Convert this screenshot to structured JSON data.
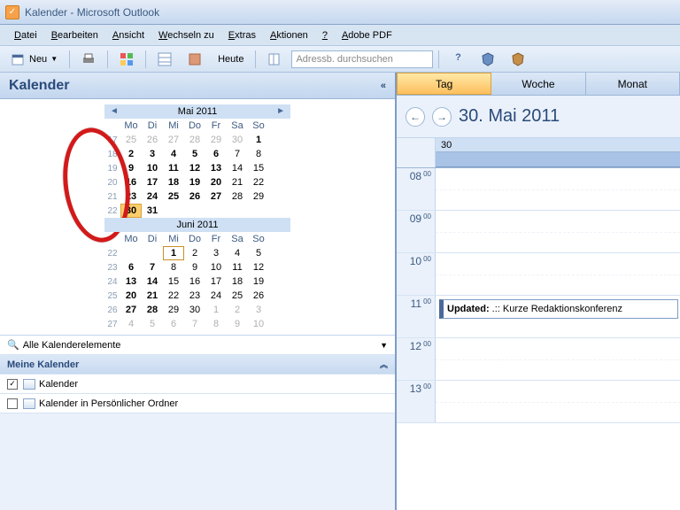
{
  "title": "Kalender - Microsoft Outlook",
  "menu": [
    "Datei",
    "Bearbeiten",
    "Ansicht",
    "Wechseln zu",
    "Extras",
    "Aktionen",
    "?",
    "Adobe PDF"
  ],
  "toolbar": {
    "neu": "Neu",
    "heute": "Heute",
    "search_placeholder": "Adressb. durchsuchen"
  },
  "sidebar": {
    "title": "Kalender",
    "all_items": "Alle Kalenderelemente",
    "my_cals": "Meine Kalender",
    "cals": [
      {
        "checked": true,
        "label": "Kalender"
      },
      {
        "checked": false,
        "label": "Kalender in Persönlicher Ordner"
      }
    ]
  },
  "minical": {
    "months": [
      {
        "title": "Mai 2011",
        "dow": [
          "Mo",
          "Di",
          "Mi",
          "Do",
          "Fr",
          "Sa",
          "So"
        ],
        "weeks": [
          {
            "wk": "17",
            "days": [
              {
                "d": 25,
                "g": 1
              },
              {
                "d": 26,
                "g": 1
              },
              {
                "d": 27,
                "g": 1
              },
              {
                "d": 28,
                "g": 1
              },
              {
                "d": 29,
                "g": 1
              },
              {
                "d": 30,
                "g": 1
              },
              {
                "d": 1,
                "b": 1
              }
            ]
          },
          {
            "wk": "18",
            "days": [
              {
                "d": 2,
                "b": 1
              },
              {
                "d": 3,
                "b": 1
              },
              {
                "d": 4,
                "b": 1
              },
              {
                "d": 5,
                "b": 1
              },
              {
                "d": 6,
                "b": 1
              },
              {
                "d": 7
              },
              {
                "d": 8
              }
            ]
          },
          {
            "wk": "19",
            "days": [
              {
                "d": 9,
                "b": 1
              },
              {
                "d": 10,
                "b": 1
              },
              {
                "d": 11,
                "b": 1
              },
              {
                "d": 12,
                "b": 1
              },
              {
                "d": 13,
                "b": 1
              },
              {
                "d": 14
              },
              {
                "d": 15
              }
            ]
          },
          {
            "wk": "20",
            "days": [
              {
                "d": 16,
                "b": 1
              },
              {
                "d": 17,
                "b": 1
              },
              {
                "d": 18,
                "b": 1
              },
              {
                "d": 19,
                "b": 1
              },
              {
                "d": 20,
                "b": 1
              },
              {
                "d": 21
              },
              {
                "d": 22
              }
            ]
          },
          {
            "wk": "21",
            "days": [
              {
                "d": 23,
                "b": 1
              },
              {
                "d": 24,
                "b": 1
              },
              {
                "d": 25,
                "b": 1
              },
              {
                "d": 26,
                "b": 1
              },
              {
                "d": 27,
                "b": 1
              },
              {
                "d": 28
              },
              {
                "d": 29
              }
            ]
          },
          {
            "wk": "22",
            "days": [
              {
                "d": 30,
                "b": 1,
                "today": 1
              },
              {
                "d": 31,
                "b": 1
              },
              {
                "d": ""
              },
              {
                "d": ""
              },
              {
                "d": ""
              },
              {
                "d": ""
              },
              {
                "d": ""
              }
            ]
          }
        ]
      },
      {
        "title": "Juni 2011",
        "dow": [
          "Mo",
          "Di",
          "Mi",
          "Do",
          "Fr",
          "Sa",
          "So"
        ],
        "weeks": [
          {
            "wk": "22",
            "days": [
              {
                "d": ""
              },
              {
                "d": ""
              },
              {
                "d": 1,
                "b": 1,
                "box": 1
              },
              {
                "d": 2
              },
              {
                "d": 3
              },
              {
                "d": 4
              },
              {
                "d": 5
              }
            ]
          },
          {
            "wk": "23",
            "days": [
              {
                "d": 6,
                "b": 1
              },
              {
                "d": 7,
                "b": 1
              },
              {
                "d": 8
              },
              {
                "d": 9
              },
              {
                "d": 10
              },
              {
                "d": 11
              },
              {
                "d": 12
              }
            ]
          },
          {
            "wk": "24",
            "days": [
              {
                "d": 13,
                "b": 1
              },
              {
                "d": 14,
                "b": 1
              },
              {
                "d": 15
              },
              {
                "d": 16
              },
              {
                "d": 17
              },
              {
                "d": 18
              },
              {
                "d": 19
              }
            ]
          },
          {
            "wk": "25",
            "days": [
              {
                "d": 20,
                "b": 1
              },
              {
                "d": 21,
                "b": 1
              },
              {
                "d": 22
              },
              {
                "d": 23
              },
              {
                "d": 24
              },
              {
                "d": 25
              },
              {
                "d": 26
              }
            ]
          },
          {
            "wk": "26",
            "days": [
              {
                "d": 27,
                "b": 1
              },
              {
                "d": 28,
                "b": 1
              },
              {
                "d": 29
              },
              {
                "d": 30
              },
              {
                "d": 1,
                "g": 1
              },
              {
                "d": 2,
                "g": 1
              },
              {
                "d": 3,
                "g": 1
              }
            ]
          },
          {
            "wk": "27",
            "days": [
              {
                "d": 4,
                "g": 1
              },
              {
                "d": 5,
                "g": 1
              },
              {
                "d": 6,
                "g": 1
              },
              {
                "d": 7,
                "g": 1
              },
              {
                "d": 8,
                "g": 1
              },
              {
                "d": 9,
                "g": 1
              },
              {
                "d": 10,
                "g": 1
              }
            ]
          }
        ]
      }
    ]
  },
  "schedule": {
    "tabs": [
      "Tag",
      "Woche",
      "Monat"
    ],
    "active_tab": 0,
    "date": "30. Mai 2011",
    "daynum": "30",
    "hours": [
      "08",
      "09",
      "10",
      "11",
      "12",
      "13"
    ],
    "appt": "Updated: .:: Kurze Redaktionskonferenz"
  }
}
